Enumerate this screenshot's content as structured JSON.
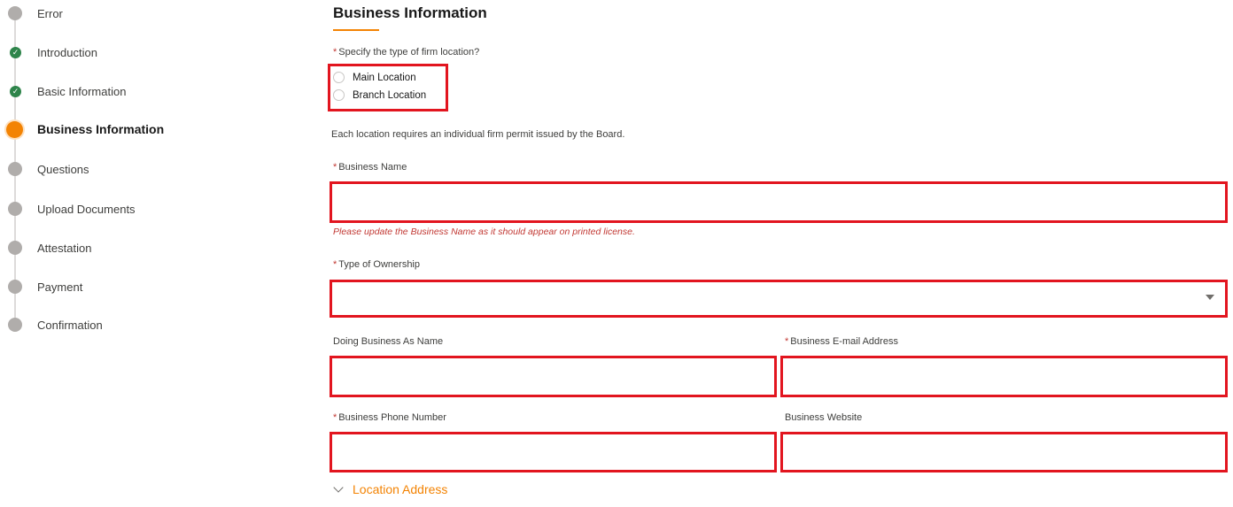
{
  "sidebar": {
    "steps": [
      {
        "label": "Error",
        "state": "pending"
      },
      {
        "label": "Introduction",
        "state": "complete"
      },
      {
        "label": "Basic Information",
        "state": "complete"
      },
      {
        "label": "Business Information",
        "state": "current"
      },
      {
        "label": "Questions",
        "state": "pending"
      },
      {
        "label": "Upload Documents",
        "state": "pending"
      },
      {
        "label": "Attestation",
        "state": "pending"
      },
      {
        "label": "Payment",
        "state": "pending"
      },
      {
        "label": "Confirmation",
        "state": "pending"
      }
    ]
  },
  "form": {
    "title": "Business Information",
    "location_type": {
      "required": "*",
      "label": "Specify the type of firm location?",
      "options": [
        "Main Location",
        "Branch Location"
      ]
    },
    "info_text": "Each location requires an individual firm permit issued by the Board.",
    "business_name": {
      "required": "*",
      "label": "Business Name",
      "value": "",
      "help": "Please update the Business Name as it should appear on printed license."
    },
    "ownership_type": {
      "required": "*",
      "label": "Type of Ownership",
      "value": ""
    },
    "dba_name": {
      "label": "Doing Business As Name",
      "value": ""
    },
    "business_email": {
      "required": "*",
      "label": "Business E-mail Address",
      "value": ""
    },
    "business_phone": {
      "required": "*",
      "label": "Business Phone Number",
      "value": ""
    },
    "business_website": {
      "label": "Business Website",
      "value": ""
    },
    "location_address": {
      "label": "Location Address"
    }
  },
  "colors": {
    "accent": "#f38303",
    "complete": "#2e844a",
    "error": "#c23934",
    "highlight_border": "#e2151f",
    "pending": "#b0adab"
  },
  "icons": {
    "complete_step": "check-icon",
    "select": "caret-down-icon",
    "accordion": "chevron-down-icon"
  }
}
